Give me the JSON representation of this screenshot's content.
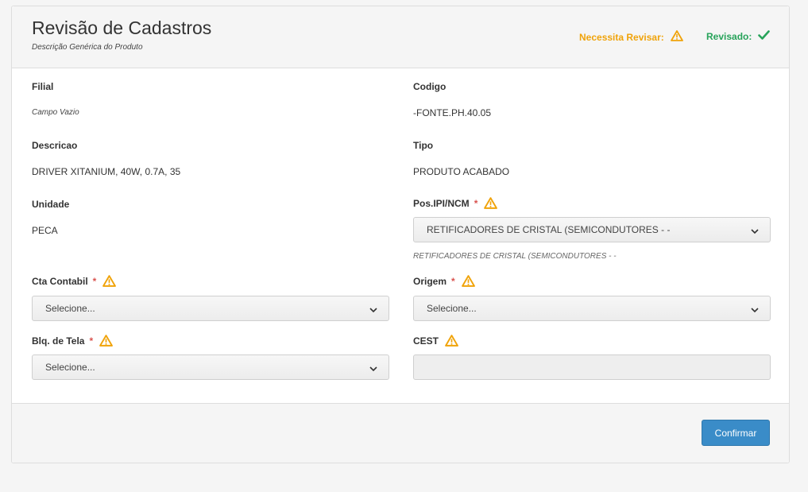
{
  "header": {
    "title": "Revisão de Cadastros",
    "subtitle": "Descrição Genérica do Produto",
    "legend_needs_review": "Necessita Revisar:",
    "legend_reviewed": "Revisado:"
  },
  "fields": {
    "filial": {
      "label": "Filial",
      "value": "Campo Vazio"
    },
    "codigo": {
      "label": "Codigo",
      "value": "-FONTE.PH.40.05"
    },
    "descricao": {
      "label": "Descricao",
      "value": "DRIVER XITANIUM, 40W, 0.7A, 35"
    },
    "tipo": {
      "label": "Tipo",
      "value": "PRODUTO ACABADO"
    },
    "unidade": {
      "label": "Unidade",
      "value": "PECA"
    },
    "posipi": {
      "label": "Pos.IPI/NCM",
      "required": "*",
      "selected": "RETIFICADORES DE CRISTAL (SEMICONDUTORES - -",
      "hint": "RETIFICADORES DE CRISTAL (SEMICONDUTORES - -"
    },
    "cta_contabil": {
      "label": "Cta Contabil",
      "required": "*",
      "selected": "Selecione..."
    },
    "origem": {
      "label": "Origem",
      "required": "*",
      "selected": "Selecione..."
    },
    "blq_tela": {
      "label": "Blq. de Tela",
      "required": "*",
      "selected": "Selecione..."
    },
    "cest": {
      "label": "CEST",
      "value": ""
    }
  },
  "footer": {
    "confirm_label": "Confirmar"
  },
  "colors": {
    "warning": "#f0a30a",
    "success": "#27a35a",
    "required": "#d9534f",
    "primary": "#3a8cc8"
  },
  "icons": {
    "needs_review": "warning-triangle-icon",
    "reviewed": "checkmark-icon",
    "dropdown": "chevron-down-icon"
  }
}
